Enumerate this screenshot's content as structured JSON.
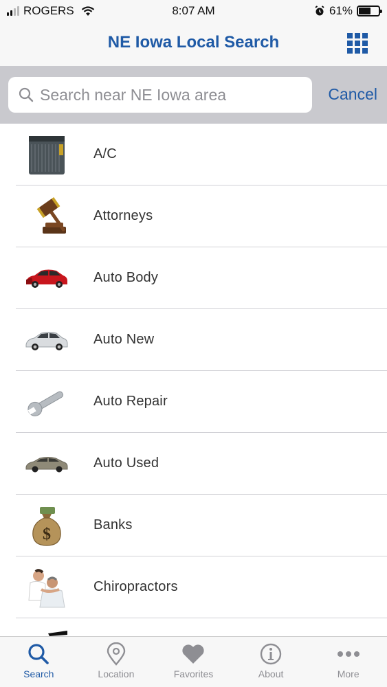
{
  "status_bar": {
    "carrier": "ROGERS",
    "time": "8:07 AM",
    "battery_percent": "61%",
    "battery_level": 0.61
  },
  "nav": {
    "title": "NE Iowa Local Search",
    "menu_icon": "grid-icon"
  },
  "search": {
    "placeholder": "Search near NE Iowa area",
    "value": "",
    "cancel_label": "Cancel"
  },
  "categories": [
    {
      "label": "A/C",
      "icon": "ac-unit-icon"
    },
    {
      "label": "Attorneys",
      "icon": "gavel-icon"
    },
    {
      "label": "Auto Body",
      "icon": "damaged-car-icon"
    },
    {
      "label": "Auto New",
      "icon": "new-car-icon"
    },
    {
      "label": "Auto Repair",
      "icon": "wrench-icon"
    },
    {
      "label": "Auto Used",
      "icon": "used-car-icon"
    },
    {
      "label": "Banks",
      "icon": "money-bag-icon"
    },
    {
      "label": "Chiropractors",
      "icon": "chiropractor-icon"
    }
  ],
  "tabs": [
    {
      "label": "Search",
      "icon": "search-icon",
      "active": true
    },
    {
      "label": "Location",
      "icon": "location-pin-icon",
      "active": false
    },
    {
      "label": "Favorites",
      "icon": "heart-icon",
      "active": false
    },
    {
      "label": "About",
      "icon": "info-icon",
      "active": false
    },
    {
      "label": "More",
      "icon": "more-icon",
      "active": false
    }
  ],
  "colors": {
    "accent": "#1f5aa6",
    "inactive": "#8e8e93",
    "search_bar_bg": "#c9c9ce"
  }
}
